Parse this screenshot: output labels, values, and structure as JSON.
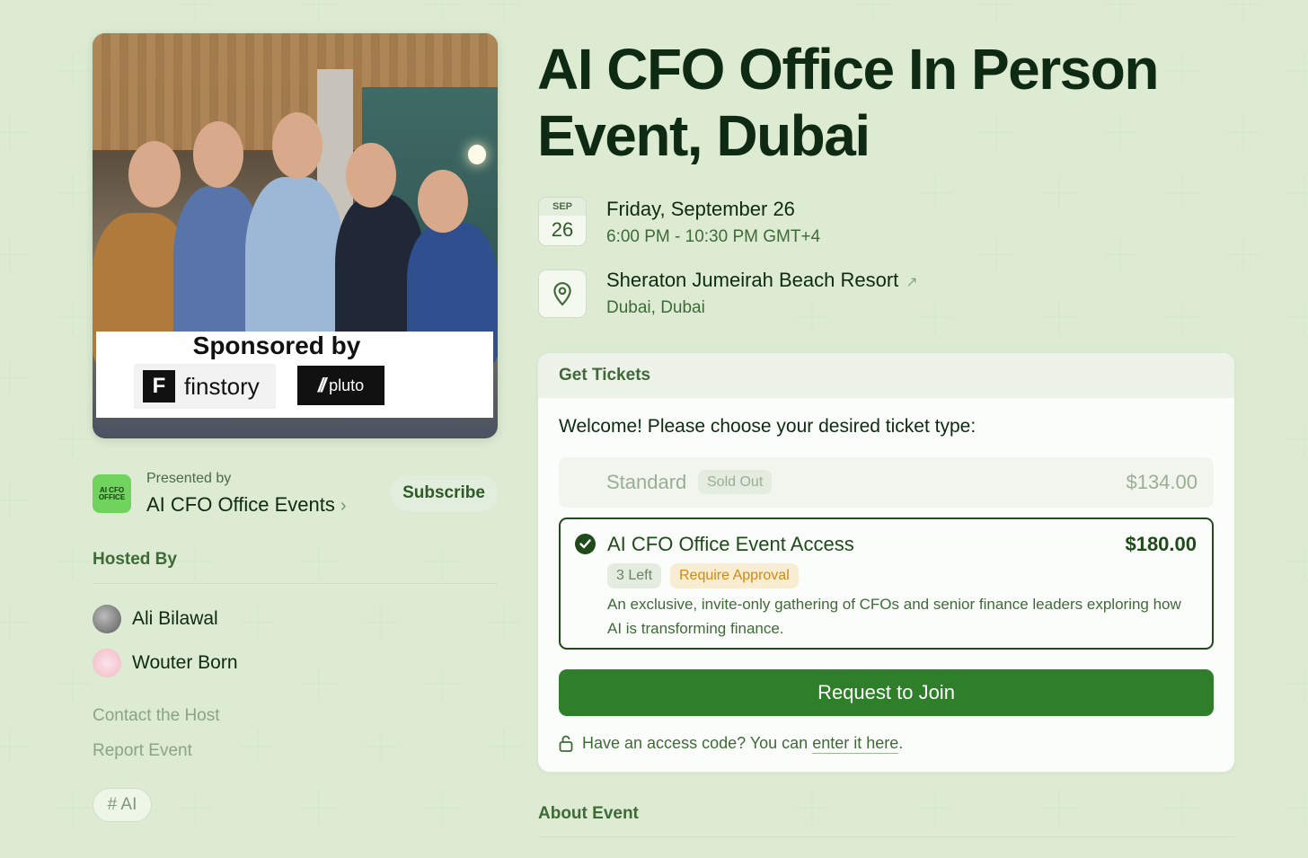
{
  "event": {
    "title": "AI CFO Office In Person Event, Dubai"
  },
  "cover": {
    "sponsor_heading": "Sponsored by",
    "sponsors": [
      {
        "name": "finstory",
        "mark": "F"
      },
      {
        "name": "pluto",
        "mark": "//"
      }
    ]
  },
  "presenter": {
    "label": "Presented by",
    "name": "AI CFO Office Events",
    "logo_text": "AI CFO OFFICE",
    "chevron": "›",
    "subscribe_label": "Subscribe"
  },
  "hosts": {
    "label": "Hosted By",
    "list": [
      {
        "name": "Ali Bilawal",
        "avatar": "photo-avatar"
      },
      {
        "name": "Wouter Born",
        "avatar": "illustrated-avatar"
      }
    ],
    "contact_label": "Contact the Host",
    "report_label": "Report Event"
  },
  "tags": [
    "# AI"
  ],
  "date": {
    "month": "SEP",
    "day": "26",
    "full": "Friday, September 26",
    "time": "6:00 PM - 10:30 PM GMT+4"
  },
  "location": {
    "name": "Sheraton Jumeirah Beach Resort",
    "arrow": "↗",
    "city": "Dubai, Dubai"
  },
  "tickets": {
    "header": "Get Tickets",
    "intro": "Welcome! Please choose your desired ticket type:",
    "options": [
      {
        "name": "Standard",
        "badge": "Sold Out",
        "price": "$134.00",
        "selected": false
      },
      {
        "name": "AI CFO Office Event Access",
        "price": "$180.00",
        "selected": true,
        "badges": [
          "3 Left",
          "Require Approval"
        ],
        "description": "An exclusive, invite-only gathering of CFOs and senior finance leaders exploring how AI is transforming finance."
      }
    ],
    "cta": "Request to Join",
    "access_prefix": "Have an access code? You can",
    "access_link": "enter it here",
    "access_suffix": "."
  },
  "about": {
    "label": "About Event"
  },
  "colors": {
    "background": "#eef6e8",
    "primary_text": "#0f2a12",
    "accent_green": "#2f7f2a",
    "muted_green": "#3f6a38",
    "approval_orange": "#d08a13"
  }
}
